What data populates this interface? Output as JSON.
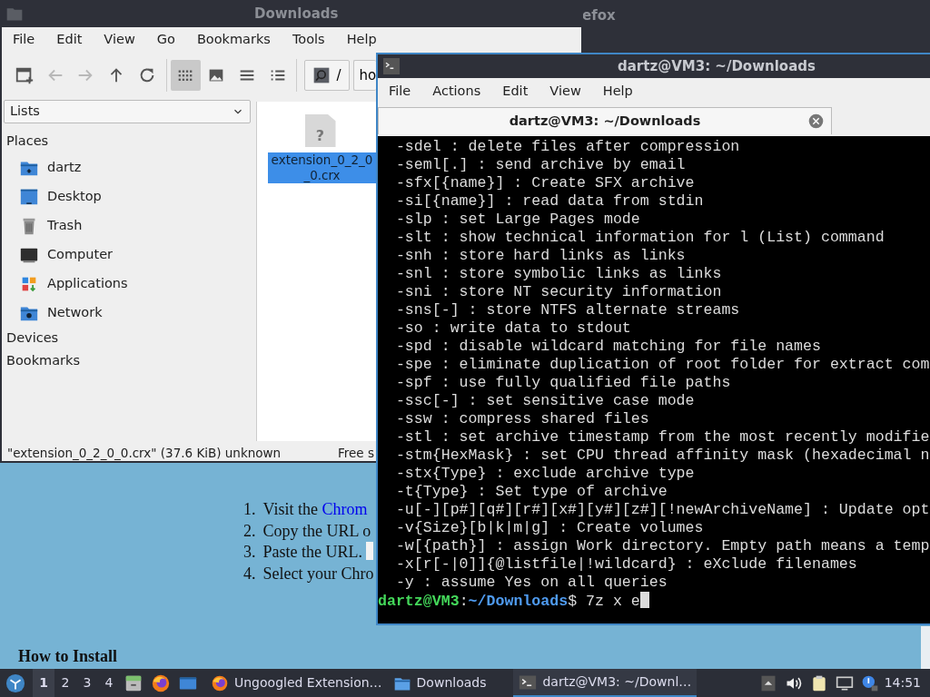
{
  "browser": {
    "title": "efox",
    "steps": [
      {
        "number": "1.",
        "text": "Visit the ",
        "link": "Chrom"
      },
      {
        "number": "2.",
        "text": "Copy the URL o"
      },
      {
        "number": "3.",
        "text": "Paste the URL.",
        "field": true
      },
      {
        "number": "4.",
        "text": "Select your Chro"
      }
    ],
    "heading": "How to Install"
  },
  "file_manager": {
    "title": "Downloads",
    "menu": [
      "File",
      "Edit",
      "View",
      "Go",
      "Bookmarks",
      "Tools",
      "Help"
    ],
    "toolbar": [
      {
        "kind": "new-tab",
        "disabled": false,
        "selected": false
      },
      {
        "kind": "back",
        "disabled": true,
        "selected": false
      },
      {
        "kind": "forward",
        "disabled": true,
        "selected": false
      },
      {
        "kind": "up",
        "disabled": false,
        "selected": false
      },
      {
        "kind": "reload",
        "disabled": false,
        "selected": false
      },
      {
        "kind": "separator"
      },
      {
        "kind": "icon-view",
        "disabled": false,
        "selected": true
      },
      {
        "kind": "thumbnail-view",
        "disabled": false,
        "selected": false
      },
      {
        "kind": "compact-view",
        "disabled": false,
        "selected": false
      },
      {
        "kind": "detail-view",
        "disabled": false,
        "selected": false
      }
    ],
    "path_buttons": [
      {
        "label": "/",
        "kind": "root"
      },
      {
        "label": "ho",
        "kind": "plain"
      }
    ],
    "side_pane_mode": "Lists",
    "sections": [
      {
        "label": "Places",
        "items": [
          {
            "label": "dartz",
            "kind": "home"
          },
          {
            "label": "Desktop",
            "kind": "desktop"
          },
          {
            "label": "Trash",
            "kind": "trash"
          },
          {
            "label": "Computer",
            "kind": "computer"
          },
          {
            "label": "Applications",
            "kind": "applications"
          },
          {
            "label": "Network",
            "kind": "network"
          }
        ]
      },
      {
        "label": "Devices"
      },
      {
        "label": "Bookmarks"
      }
    ],
    "files": [
      {
        "name": "extension_0_2_0_0.crx",
        "icon_glyph": "?",
        "selected": true
      }
    ],
    "status": "\"extension_0_2_0_0.crx\" (37.6 KiB) unknown",
    "free_space": "Free s"
  },
  "terminal": {
    "title": "dartz@VM3: ~/Downloads",
    "menu": [
      "File",
      "Actions",
      "Edit",
      "View",
      "Help"
    ],
    "tabs": [
      {
        "label": "dartz@VM3: ~/Downloads",
        "selected": true
      }
    ],
    "lines": [
      "  -sdel : delete files after compression",
      "  -seml[.] : send archive by email",
      "  -sfx[{name}] : Create SFX archive",
      "  -si[{name}] : read data from stdin",
      "  -slp : set Large Pages mode",
      "  -slt : show technical information for l (List) command",
      "  -snh : store hard links as links",
      "  -snl : store symbolic links as links",
      "  -sni : store NT security information",
      "  -sns[-] : store NTFS alternate streams",
      "  -so : write data to stdout",
      "  -spd : disable wildcard matching for file names",
      "  -spe : eliminate duplication of root folder for extract com",
      "  -spf : use fully qualified file paths",
      "  -ssc[-] : set sensitive case mode",
      "  -ssw : compress shared files",
      "  -stl : set archive timestamp from the most recently modifie",
      "  -stm{HexMask} : set CPU thread affinity mask (hexadecimal n",
      "  -stx{Type} : exclude archive type",
      "  -t{Type} : Set type of archive",
      "  -u[-][p#][q#][r#][x#][y#][z#][!newArchiveName] : Update opt",
      "  -v{Size}[b|k|m|g] : Create volumes",
      "  -w[{path}] : assign Work directory. Empty path means a temp",
      "  -x[r[-|0]]{@listfile|!wildcard} : eXclude filenames",
      "  -y : assume Yes on all queries"
    ],
    "prompt": {
      "host": "dartz@VM3",
      "separator": ":",
      "path": "~/Downloads",
      "command": "$ 7z x e"
    }
  },
  "taskbar": {
    "workspaces": [
      {
        "label": "1",
        "selected": true
      },
      {
        "label": "2",
        "selected": false
      },
      {
        "label": "3",
        "selected": false
      },
      {
        "label": "4",
        "selected": false
      }
    ],
    "launchers": [
      {
        "kind": "files"
      },
      {
        "kind": "browser"
      },
      {
        "kind": "desktop"
      }
    ],
    "tasks": [
      {
        "label": "Ungoogled Extension…",
        "kind": "browser",
        "selected": false
      },
      {
        "label": "Downloads",
        "kind": "folder",
        "selected": false
      },
      {
        "label": "dartz@VM3: ~/Downl…",
        "kind": "terminal",
        "selected": true
      }
    ],
    "tray": [
      {
        "kind": "arrow"
      },
      {
        "kind": "volume"
      },
      {
        "kind": "clipboard"
      },
      {
        "kind": "network"
      },
      {
        "kind": "notification"
      }
    ],
    "clock": "14:51"
  }
}
